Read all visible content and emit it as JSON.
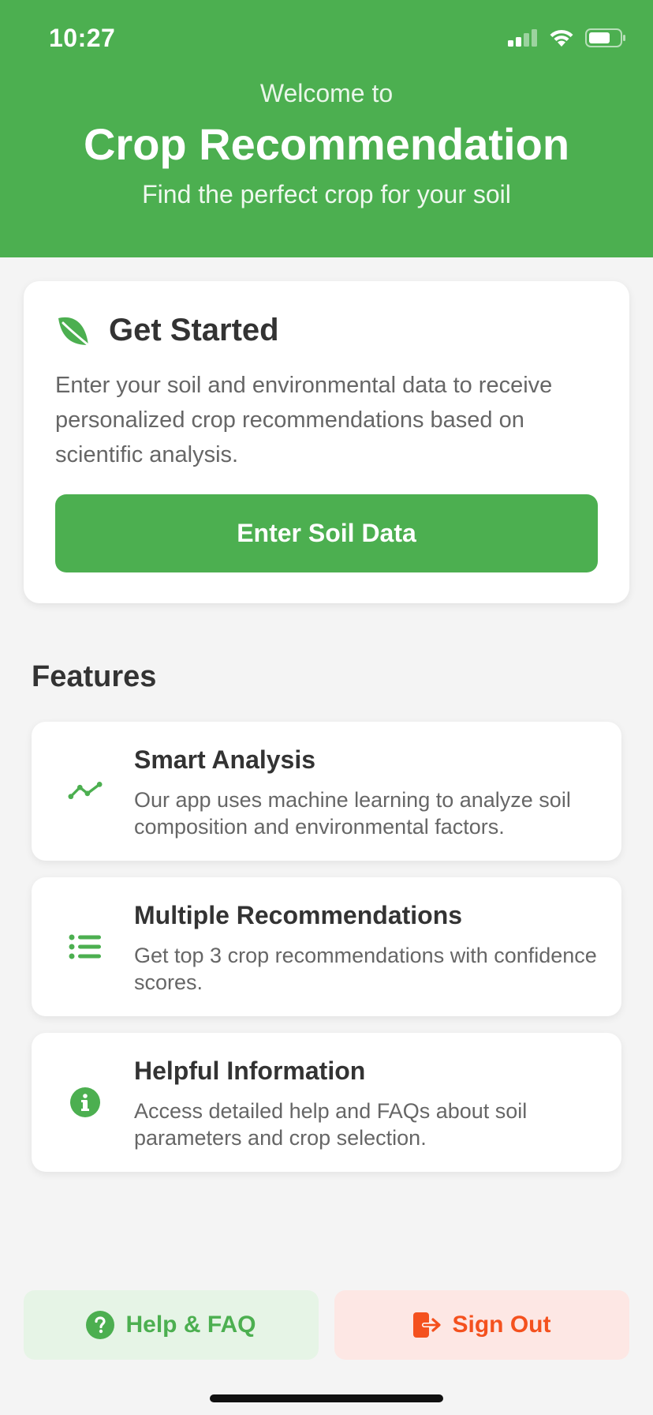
{
  "status_bar": {
    "time": "10:27",
    "icons": [
      "signal-icon",
      "wifi-icon",
      "battery-icon"
    ]
  },
  "header": {
    "welcome": "Welcome to",
    "title": "Crop Recommendation",
    "subtitle": "Find the perfect crop for your soil"
  },
  "get_started": {
    "icon": "leaf-icon",
    "title": "Get Started",
    "description": "Enter your soil and environmental data to receive personalized crop recommendations based on scientific analysis.",
    "button_label": "Enter Soil Data"
  },
  "features": {
    "heading": "Features",
    "items": [
      {
        "icon": "trend-line-icon",
        "title": "Smart Analysis",
        "description": "Our app uses machine learning to analyze soil composition and environmental factors."
      },
      {
        "icon": "list-icon",
        "title": "Multiple Recommendations",
        "description": "Get top 3 crop recommendations with confidence scores."
      },
      {
        "icon": "info-icon",
        "title": "Helpful Information",
        "description": "Access detailed help and FAQs about soil parameters and crop selection."
      }
    ]
  },
  "actions": {
    "help_label": "Help & FAQ",
    "help_icon": "question-circle-icon",
    "signout_label": "Sign Out",
    "signout_icon": "sign-out-icon"
  },
  "colors": {
    "primary": "#4caf50",
    "danger": "#f4511e",
    "background": "#f4f4f4",
    "help_button_bg": "#e6f4e6",
    "signout_button_bg": "#fde7e4"
  }
}
